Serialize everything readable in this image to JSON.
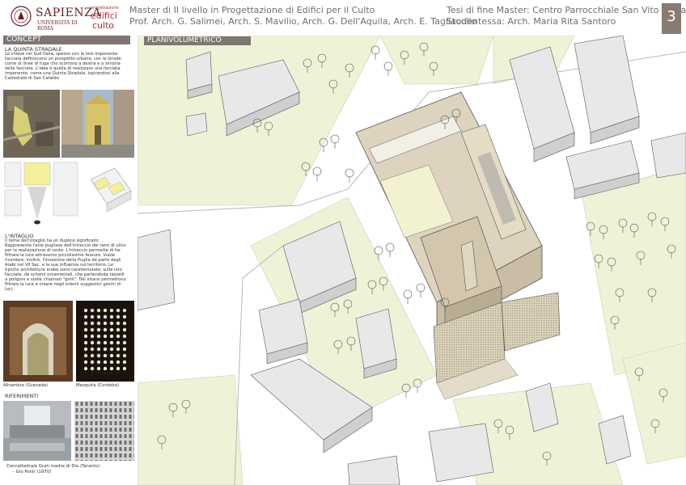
{
  "header": {
    "brand": "SAPIENZA",
    "brand_sub": "UNIVERSITÀ DI ROMA",
    "master_logo_line1": "progettazione",
    "master_logo_line2": "edifici",
    "master_logo_line3": "culto",
    "master_title": "Master di II livello in Progettazione di Edifici per il Culto",
    "professors": "Prof. Arch. G. Salimei, Arch. S. Mavilio, Arch. G. Dell'Aquila, Arch. E. Tagliacollo",
    "thesis": "Tesi di fine Master: Centro Parrocchiale San Vito - Taranto",
    "student": "Studentessa: Arch. Maria Rita Santoro",
    "page": "3"
  },
  "sidebar": {
    "concept_title": "CONCEPT",
    "quinta_title": "LA QUINTA STRADALE",
    "quinta_text": "Le chiese nel Sud Italia, spesso con la loro imponente facciata definiscono un prospetto urbano, con le strade come di linee di fuga che scorrono a destra e a sinistra della facciata. L'idea è quella di realizzare una facciata imponente, come una Quinta Stradale, ispirandosi alla Cattedrale di San Cataldo.",
    "intaglio_title": "L'INTAGLIO",
    "intaglio_text": "Il tema dell'intaglio ha un duplice significato: Rappresenta l'arte pugliese dell'intreccio dei rami di ulivo per la realizzazione di ceste. L'intreccio permette di far filtrare la luce attraverso piccolissime fessure. Vuole ricordare, inoltre, l'invasione della Puglia da parte degli Arabi nel VII Sec. e la sua influenza sul territorio. Le tipiche architetture arabe sono caratterizzate, sulle loro facciate, da schemi ornamentali, che partendoda tasselli a poligoni e stelle chiamati \"girih\". Tali intarsi permettono filtrare la luce e creare negli interni suggestivi giochi di luci.",
    "caption_alhambra": "Alhambra (Granada)",
    "caption_mezquita": "Mezquita (Cordoba)",
    "riferimenti_title": "RIFERIMENTI",
    "caption_concattedrale_1": "Concattedrale Gran madre di Dio (Taranto)",
    "caption_concattedrale_2": "- Gio Ponti (1970)"
  },
  "plan": {
    "label": "PLANIVOLUMETRICO"
  },
  "colors": {
    "header_badge": "#8a7b72",
    "section_bar": "#7d7673",
    "brand": "#6b1d1d",
    "lawn": "#eef3d8",
    "road": "#ffffff",
    "building_top": "#e8e8e8",
    "project_top": "#ddd3bf",
    "accent_yellow": "#f4ef9a"
  }
}
